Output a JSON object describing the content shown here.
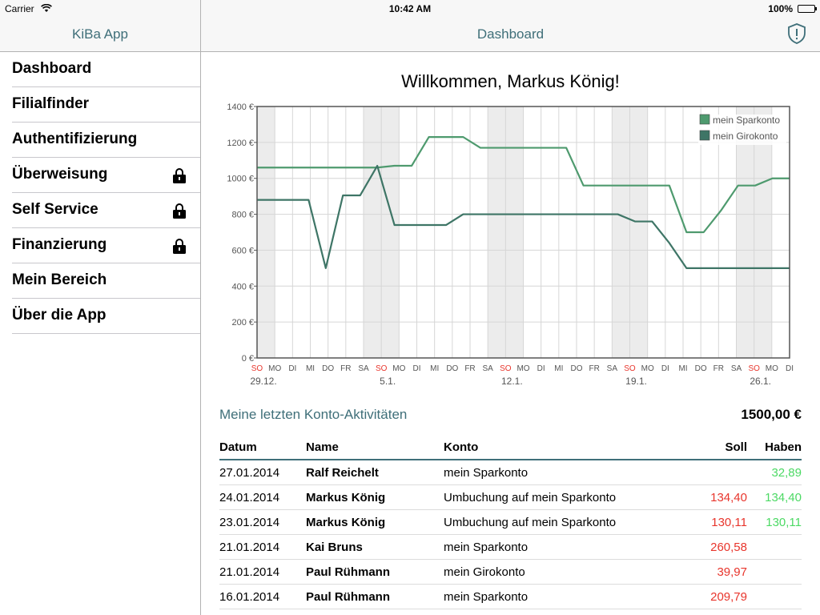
{
  "status": {
    "carrier": "Carrier",
    "time": "10:42 AM",
    "battery": "100%"
  },
  "nav": {
    "left_title": "KiBa App",
    "right_title": "Dashboard"
  },
  "sidebar": {
    "items": [
      {
        "label": "Dashboard",
        "locked": false
      },
      {
        "label": "Filialfinder",
        "locked": false
      },
      {
        "label": "Authentifizierung",
        "locked": false
      },
      {
        "label": "Überweisung",
        "locked": true
      },
      {
        "label": "Self Service",
        "locked": true
      },
      {
        "label": "Finanzierung",
        "locked": true
      },
      {
        "label": "Mein Bereich",
        "locked": false
      },
      {
        "label": "Über die App",
        "locked": false
      }
    ]
  },
  "main": {
    "welcome": "Willkommen, Markus König!"
  },
  "chart_data": {
    "type": "line",
    "title": "",
    "y_ticks": [
      "0 €",
      "200 €",
      "400 €",
      "600 €",
      "800 €",
      "1000 €",
      "1200 €",
      "1400 €"
    ],
    "ylim": [
      0,
      1400
    ],
    "x_day_labels": [
      "SO",
      "MO",
      "DI",
      "MI",
      "DO",
      "FR",
      "SA",
      "SO",
      "MO",
      "DI",
      "MI",
      "DO",
      "FR",
      "SA",
      "SO",
      "MO",
      "DI",
      "MI",
      "DO",
      "FR",
      "SA",
      "SO",
      "MO",
      "DI",
      "MI",
      "DO",
      "FR",
      "SA",
      "SO",
      "MO",
      "DI"
    ],
    "x_date_labels": [
      {
        "index": 0,
        "label": "29.12."
      },
      {
        "index": 7,
        "label": "5.1."
      },
      {
        "index": 14,
        "label": "12.1."
      },
      {
        "index": 21,
        "label": "19.1."
      },
      {
        "index": 28,
        "label": "26.1."
      }
    ],
    "weekend_shading": [
      [
        6,
        8
      ],
      [
        13,
        15
      ],
      [
        20,
        22
      ],
      [
        27,
        29
      ]
    ],
    "legend_position": "top-right",
    "colors": {
      "sparkonto": "#4e9a6e",
      "girokonto": "#3e7566",
      "sunday_label": "#e8352c",
      "weekend_band": "#ececec"
    },
    "series": [
      {
        "name": "mein Sparkonto",
        "values": [
          1060,
          1060,
          1060,
          1060,
          1060,
          1060,
          1060,
          1060,
          1070,
          1070,
          1230,
          1230,
          1230,
          1170,
          1170,
          1170,
          1170,
          1170,
          1170,
          960,
          960,
          960,
          960,
          960,
          960,
          700,
          700,
          820,
          960,
          960,
          1000,
          1000
        ]
      },
      {
        "name": "mein Girokonto",
        "values": [
          880,
          880,
          880,
          880,
          500,
          905,
          905,
          1070,
          740,
          740,
          740,
          740,
          800,
          800,
          800,
          800,
          800,
          800,
          800,
          800,
          800,
          800,
          760,
          760,
          640,
          500,
          500,
          500,
          500,
          500,
          500,
          500
        ]
      }
    ]
  },
  "activities": {
    "title": "Meine letzten Konto-Aktivitäten",
    "total": "1500,00 €",
    "columns": {
      "date": "Datum",
      "name": "Name",
      "account": "Konto",
      "debit": "Soll",
      "credit": "Haben"
    },
    "rows": [
      {
        "date": "27.01.2014",
        "name": "Ralf Reichelt",
        "account": "mein Sparkonto",
        "debit": "",
        "credit": "32,89"
      },
      {
        "date": "24.01.2014",
        "name": "Markus König",
        "account": "Umbuchung auf mein Sparkonto",
        "debit": "134,40",
        "credit": "134,40"
      },
      {
        "date": "23.01.2014",
        "name": "Markus König",
        "account": "Umbuchung auf mein Sparkonto",
        "debit": "130,11",
        "credit": "130,11"
      },
      {
        "date": "21.01.2014",
        "name": "Kai Bruns",
        "account": "mein Sparkonto",
        "debit": "260,58",
        "credit": ""
      },
      {
        "date": "21.01.2014",
        "name": "Paul Rühmann",
        "account": "mein Girokonto",
        "debit": "39,97",
        "credit": ""
      },
      {
        "date": "16.01.2014",
        "name": "Paul Rühmann",
        "account": "mein Sparkonto",
        "debit": "209,79",
        "credit": ""
      }
    ]
  },
  "icons": {
    "shield": "shield-alert-icon",
    "lock": "lock-icon",
    "wifi": "wifi-icon",
    "battery": "battery-icon"
  }
}
